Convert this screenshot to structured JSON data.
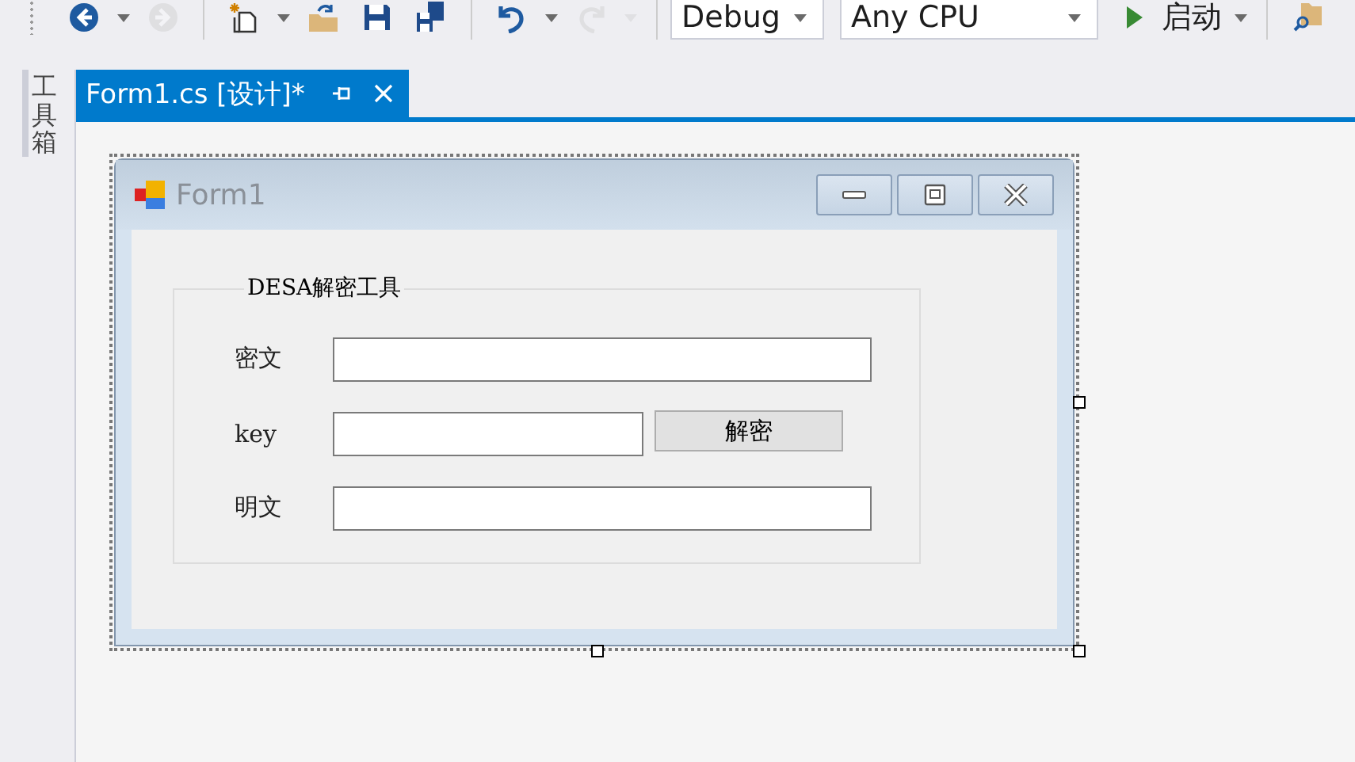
{
  "toolbar": {
    "buttons": [
      {
        "kind": "back",
        "disabled": false
      },
      {
        "kind": "caret",
        "disabled": false
      },
      {
        "kind": "forward",
        "disabled": true
      },
      {
        "kind": "sep"
      },
      {
        "kind": "new",
        "disabled": false
      },
      {
        "kind": "caret",
        "disabled": false
      },
      {
        "kind": "open",
        "disabled": false
      },
      {
        "kind": "save",
        "disabled": false
      },
      {
        "kind": "saveall",
        "disabled": false
      },
      {
        "kind": "sep"
      },
      {
        "kind": "undo",
        "disabled": false
      },
      {
        "kind": "caret",
        "disabled": false
      },
      {
        "kind": "redo",
        "disabled": true
      },
      {
        "kind": "caret",
        "disabled": true
      },
      {
        "kind": "sep"
      }
    ],
    "configuration": "Debug",
    "platform": "Any CPU",
    "start": "启动"
  },
  "sidebar": {
    "label": "工具箱"
  },
  "tabs": [
    {
      "title": "Form1.cs [设计]*",
      "selected": true
    }
  ],
  "form": {
    "title": "Form1",
    "group": {
      "legend": "DESA解密工具",
      "rows": [
        {
          "label": "密文",
          "kind": "wide"
        },
        {
          "label": "key",
          "kind": "button",
          "button": "解密"
        },
        {
          "label": "明文",
          "kind": "wide"
        }
      ]
    }
  }
}
